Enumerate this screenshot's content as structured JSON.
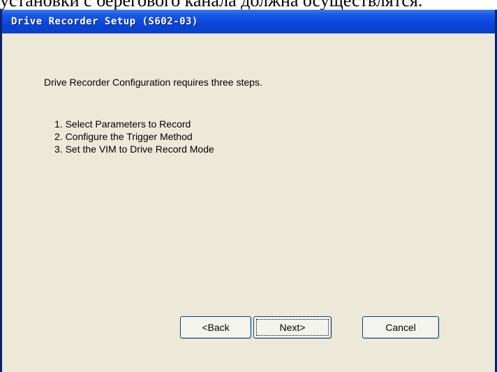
{
  "background_caption": "установки с берегового канала должна осуществлятся.",
  "window": {
    "title": "Drive Recorder Setup (S602-03)"
  },
  "content": {
    "intro": "Drive Recorder Configuration requires three steps.",
    "steps": [
      "1. Select Parameters to Record",
      "2. Configure the Trigger Method",
      "3. Set the VIM to Drive Record Mode"
    ]
  },
  "buttons": {
    "back": "<Back",
    "next": "Next>",
    "cancel": "Cancel"
  },
  "colors": {
    "title_bar": "#0a45d8",
    "dialog_face": "#ece9d8",
    "title_text": "#ffffff"
  }
}
